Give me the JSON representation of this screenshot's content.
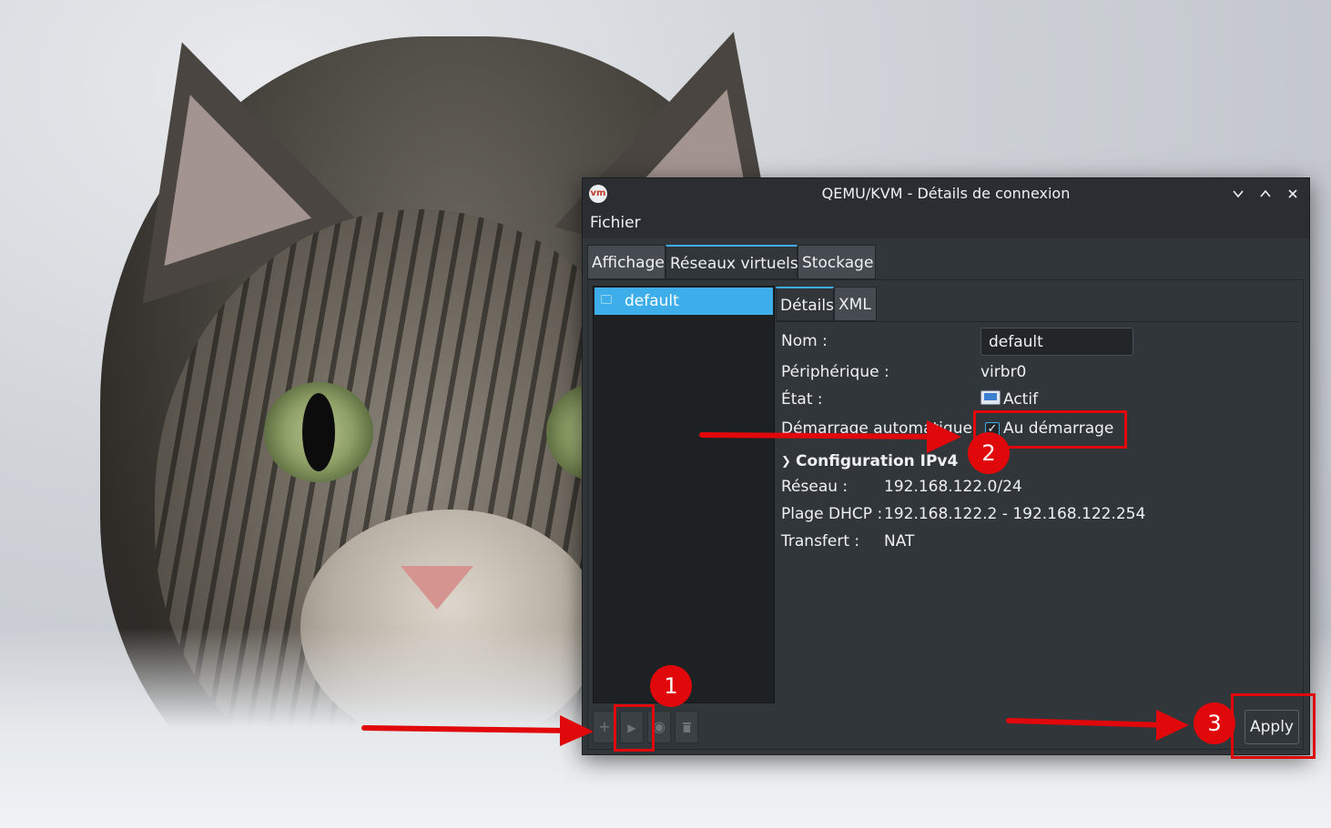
{
  "wallpaper": {
    "subject": "tabby cat in snow"
  },
  "window": {
    "title": "QEMU/KVM - Détails de connexion",
    "icon": "virt-manager-icon",
    "controls": [
      "chevron-down-icon",
      "chevron-up-icon",
      "close-icon"
    ]
  },
  "menubar": {
    "file": "Fichier"
  },
  "tabs": [
    "Affichage",
    "Réseaux virtuels",
    "Stockage"
  ],
  "active_tab": "Réseaux virtuels",
  "network_list": {
    "items": [
      {
        "label": "default",
        "icon": "network-icon",
        "selected": true
      }
    ]
  },
  "toolbar": {
    "buttons": [
      "add-icon",
      "play-icon",
      "stop-icon",
      "delete-icon"
    ]
  },
  "detail_tabs": [
    "Détails",
    "XML"
  ],
  "active_detail_tab": "Détails",
  "details": {
    "name_label": "Nom :",
    "name_value": "default",
    "device_label": "Périphérique :",
    "device_value": "virbr0",
    "state_label": "État :",
    "state_value": "Actif",
    "autostart_label": "Démarrage automatique",
    "autostart_check_label": "Au démarrage",
    "autostart_checked": true
  },
  "ipv4": {
    "section_title": "Configuration IPv4",
    "network_label": "Réseau :",
    "network_value": "192.168.122.0/24",
    "dhcp_label": "Plage DHCP :",
    "dhcp_value": "192.168.122.2 - 192.168.122.254",
    "forward_label": "Transfert :",
    "forward_value": "NAT"
  },
  "apply_label": "Apply",
  "annotations": {
    "badge1": "1",
    "badge2": "2",
    "badge3": "3",
    "color": "#e0080a"
  }
}
